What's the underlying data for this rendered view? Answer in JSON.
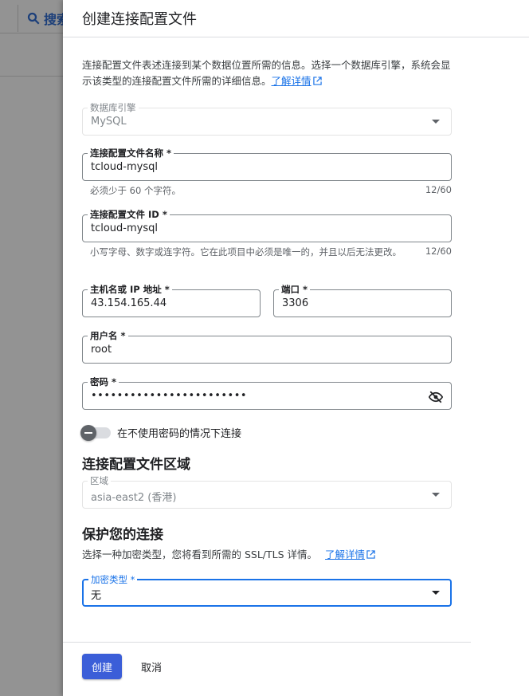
{
  "background": {
    "search_label": "搜索"
  },
  "dialog": {
    "title": "创建连接配置文件",
    "description": "连接配置文件表述连接到某个数据位置所需的信息。选择一个数据库引擎，系统会显示该类型的连接配置文件所需的详细信息。",
    "learn_more": "了解详情"
  },
  "fields": {
    "engine": {
      "label": "数据库引擎",
      "value": "MySQL"
    },
    "profile_name": {
      "label": "连接配置文件名称 *",
      "value": "tcloud-mysql",
      "hint": "必须少于 60 个字符。",
      "counter": "12/60"
    },
    "profile_id": {
      "label": "连接配置文件 ID *",
      "value": "tcloud-mysql",
      "hint": "小写字母、数字或连字符。它在此项目中必须是唯一的，并且以后无法更改。",
      "counter": "12/60"
    },
    "hostname": {
      "label": "主机名或 IP 地址 *",
      "value": "43.154.165.44"
    },
    "port": {
      "label": "端口 *",
      "value": "3306"
    },
    "username": {
      "label": "用户名 *",
      "value": "root"
    },
    "password": {
      "label": "密码 *",
      "value": "••••••••••••••••••••••••"
    },
    "no_password_toggle": {
      "label": "在不使用密码的情况下连接",
      "on": false
    }
  },
  "region_section": {
    "title": "连接配置文件区域",
    "field": {
      "label": "区域",
      "value": "asia-east2 (香港)"
    }
  },
  "security_section": {
    "title": "保护您的连接",
    "description": "选择一种加密类型，您将看到所需的 SSL/TLS 详情。",
    "learn_more": "了解详情",
    "field": {
      "label": "加密类型 *",
      "value": "无"
    }
  },
  "footer": {
    "create_label": "创建",
    "cancel_label": "取消"
  },
  "colors": {
    "accent": "#1a73e8",
    "primary_button": "#3b5ed8"
  }
}
